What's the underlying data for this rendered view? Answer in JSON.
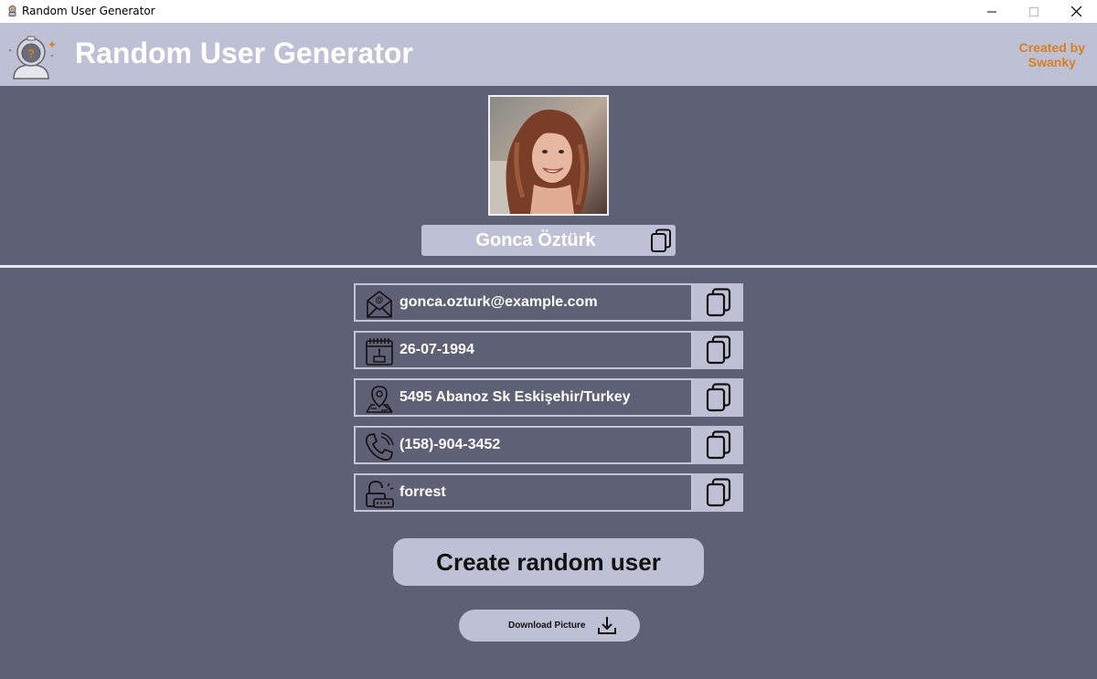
{
  "window": {
    "title": "Random User Generator",
    "icon": "astronaut-icon",
    "controls": [
      "minimize-icon",
      "maximize-icon",
      "close-icon"
    ]
  },
  "header": {
    "title": "Random User Generator",
    "credit_line1": "Created by",
    "credit_line2": "Swanky",
    "logo_icon": "astronaut-question-icon"
  },
  "profile": {
    "photo_icon": "profile-photo",
    "name": "Gonca Öztürk",
    "copy_icon": "copy-icon"
  },
  "fields": [
    {
      "icon": "email-icon",
      "value": "gonca.ozturk@example.com"
    },
    {
      "icon": "calendar-birthday-icon",
      "value": "26-07-1994"
    },
    {
      "icon": "location-map-icon",
      "value": "5495 Abanoz Sk Eskişehir/Turkey"
    },
    {
      "icon": "phone-icon",
      "value": "(158)-904-3452"
    },
    {
      "icon": "password-lock-icon",
      "value": "forrest"
    }
  ],
  "actions": {
    "create_label": "Create random user",
    "download_label": "Download Picture",
    "download_icon": "download-icon"
  },
  "colors": {
    "background": "#5e6075",
    "panel": "#bec1d6",
    "accent": "#d7801c",
    "text": "#ffffff"
  }
}
